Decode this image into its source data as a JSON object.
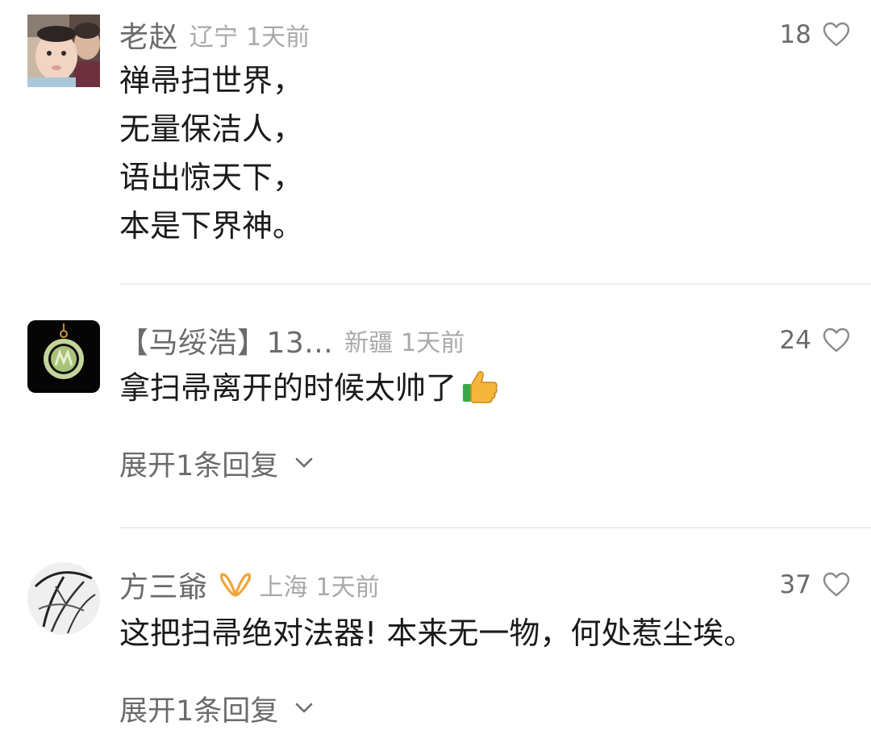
{
  "comments": [
    {
      "username": "老赵",
      "location": "辽宁",
      "time": "1天前",
      "likes": "18",
      "avatar_icon": "child-photo-avatar",
      "lines": [
        "禅帚扫世界，",
        "无量保洁人，",
        "语出惊天下，",
        "本是下界神。"
      ]
    },
    {
      "username": "【马绥浩】13...",
      "location": "新疆",
      "time": "1天前",
      "likes": "24",
      "avatar_icon": "jade-pendant-avatar",
      "text": "拿扫帚离开的时候太帅了",
      "emoji_icon": "thumbs-up-icon",
      "expand_label": "展开1条回复"
    },
    {
      "username": "方三爺",
      "badge_icon": "gold-ribbon-badge-icon",
      "location": "上海",
      "time": "1天前",
      "likes": "37",
      "avatar_icon": "ink-sketch-avatar",
      "text": "这把扫帚绝对法器! 本来无一物，何处惹尘埃。",
      "expand_label": "展开1条回复"
    }
  ],
  "colors": {
    "username": "#6b6b6b",
    "meta": "#a9a9a9",
    "body": "#1a1a1a",
    "divider": "#ececec",
    "badge": "#f0a43a"
  }
}
